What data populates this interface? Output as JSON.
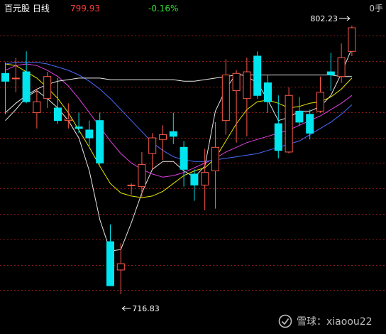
{
  "header": {
    "title": "百元股 日线",
    "price": "799.93",
    "change": "-0.16%",
    "volume_label": "0手"
  },
  "watermark": {
    "text": "雪球：xiaoou22"
  },
  "colors": {
    "background": "#000000",
    "up_candle": "#ff5a4a",
    "down_candle": "#00e5ee",
    "grid": "#8b1a1a",
    "ma_white": "#e8e8e8",
    "ma_yellow": "#e6e600",
    "ma_magenta": "#e040e0",
    "ma_blue": "#4a6cff",
    "price_up": "#ff3b3b",
    "price_down": "#33dd33"
  },
  "chart_data": {
    "type": "candlestick",
    "period": "日线",
    "ylim": [
      710,
      810
    ],
    "max_label": "802.23",
    "min_label": "716.83",
    "grid": true,
    "candles": [
      {
        "o": 787.0,
        "c": 784.5,
        "h": 790.5,
        "l": 774.0
      },
      {
        "o": 785.5,
        "c": 785.5,
        "h": 792.0,
        "l": 781.0
      },
      {
        "o": 787.5,
        "c": 778.0,
        "h": 794.0,
        "l": 777.5
      },
      {
        "o": 774.5,
        "c": 778.0,
        "h": 782.0,
        "l": 769.5
      },
      {
        "o": 779.0,
        "c": 786.0,
        "h": 787.5,
        "l": 776.0
      },
      {
        "o": 776.0,
        "c": 772.0,
        "h": 785.5,
        "l": 771.0
      },
      {
        "o": 772.0,
        "c": 772.5,
        "h": 777.5,
        "l": 769.5
      },
      {
        "o": 770.0,
        "c": 769.5,
        "h": 774.5,
        "l": 768.0
      },
      {
        "o": 769.0,
        "c": 766.5,
        "h": 772.0,
        "l": 764.0
      },
      {
        "o": 772.0,
        "c": 758.5,
        "h": 774.5,
        "l": 758.0
      },
      {
        "o": 733.5,
        "c": 719.5,
        "h": 739.0,
        "l": 719.5
      },
      {
        "o": 724.5,
        "c": 726.5,
        "h": 733.0,
        "l": 716.8
      },
      {
        "o": 751.5,
        "c": 751.5,
        "h": 752.0,
        "l": 748.5
      },
      {
        "o": 751.0,
        "c": 758.0,
        "h": 762.0,
        "l": 747.5
      },
      {
        "o": 761.5,
        "c": 766.5,
        "h": 768.0,
        "l": 756.5
      },
      {
        "o": 766.0,
        "c": 767.5,
        "h": 770.5,
        "l": 759.5
      },
      {
        "o": 768.5,
        "c": 767.0,
        "h": 774.5,
        "l": 764.5
      },
      {
        "o": 763.5,
        "c": 756.5,
        "h": 765.5,
        "l": 751.0
      },
      {
        "o": 755.0,
        "c": 751.5,
        "h": 756.5,
        "l": 746.5
      },
      {
        "o": 751.5,
        "c": 755.5,
        "h": 763.0,
        "l": 743.5
      },
      {
        "o": 756.0,
        "c": 763.5,
        "h": 771.5,
        "l": 744.0
      },
      {
        "o": 772.0,
        "c": 786.5,
        "h": 791.5,
        "l": 767.5
      },
      {
        "o": 781.5,
        "c": 787.0,
        "h": 788.0,
        "l": 765.0
      },
      {
        "o": 779.0,
        "c": 787.5,
        "h": 792.0,
        "l": 767.0
      },
      {
        "o": 792.5,
        "c": 780.0,
        "h": 794.0,
        "l": 779.0
      },
      {
        "o": 784.0,
        "c": 778.0,
        "h": 786.5,
        "l": 774.5
      },
      {
        "o": 771.0,
        "c": 762.5,
        "h": 780.0,
        "l": 760.0
      },
      {
        "o": 762.0,
        "c": 780.0,
        "h": 782.5,
        "l": 761.5
      },
      {
        "o": 775.0,
        "c": 771.5,
        "h": 779.5,
        "l": 770.5
      },
      {
        "o": 774.0,
        "c": 768.0,
        "h": 775.5,
        "l": 766.0
      },
      {
        "o": 775.0,
        "c": 781.0,
        "h": 786.0,
        "l": 774.5
      },
      {
        "o": 787.5,
        "c": 786.5,
        "h": 793.5,
        "l": 781.5
      },
      {
        "o": 786.0,
        "c": 792.0,
        "h": 796.5,
        "l": 784.0
      },
      {
        "o": 794.0,
        "c": 801.5,
        "h": 802.2,
        "l": 792.5
      }
    ],
    "ma_lines": [
      {
        "color": "#e8e8e8",
        "y": [
          772.0,
          775.5,
          779.5,
          781.5,
          779.0,
          776.0,
          772.0,
          766.5,
          756.0,
          740.5,
          730.5,
          731.0,
          739.5,
          749.0,
          756.5,
          759.0,
          759.0,
          756.0,
          754.0,
          757.5,
          775.0,
          782.0,
          787.0,
          786.0,
          784.0,
          778.5,
          772.0,
          773.0,
          775.0,
          775.0,
          776.5,
          780.0,
          787.0,
          795.0
        ]
      },
      {
        "color": "#e6e600",
        "y": [
          790.0,
          789.5,
          787.5,
          785.5,
          782.5,
          779.0,
          774.5,
          769.0,
          763.5,
          757.5,
          752.0,
          749.0,
          748.0,
          747.5,
          748.0,
          749.5,
          752.0,
          754.5,
          756.0,
          757.0,
          760.0,
          765.5,
          771.0,
          775.5,
          778.0,
          778.5,
          777.5,
          776.0,
          776.5,
          777.5,
          778.0,
          779.5,
          782.0,
          785.5
        ]
      },
      {
        "color": "#e040e0",
        "y": [
          788.0,
          789.5,
          790.0,
          789.5,
          788.0,
          786.0,
          783.0,
          779.0,
          774.5,
          770.0,
          765.5,
          761.5,
          758.5,
          756.5,
          755.0,
          754.0,
          754.5,
          755.5,
          757.0,
          758.5,
          760.0,
          762.0,
          763.5,
          765.0,
          766.0,
          767.0,
          768.0,
          769.0,
          770.5,
          772.0,
          773.5,
          775.5,
          777.5,
          780.0
        ]
      },
      {
        "color": "#4a6cff",
        "y": [
          790.0,
          790.5,
          790.5,
          790.5,
          790.0,
          789.0,
          788.0,
          786.5,
          784.5,
          782.0,
          779.0,
          775.5,
          772.0,
          768.5,
          765.0,
          762.5,
          760.5,
          759.5,
          759.0,
          759.0,
          759.5,
          760.0,
          760.5,
          761.0,
          761.5,
          762.5,
          763.5,
          764.5,
          765.5,
          767.5,
          769.5,
          771.5,
          774.0,
          777.0
        ]
      },
      {
        "color": "#e8e8e8",
        "y": [
          774.5,
          777.5,
          780.0,
          782.0,
          783.5,
          784.5,
          785.0,
          785.5,
          785.5,
          785.5,
          785.0,
          785.0,
          785.0,
          785.0,
          785.0,
          785.0,
          785.0,
          784.5,
          784.5,
          785.0,
          785.5,
          786.0,
          786.5,
          786.5,
          786.5,
          786.5,
          786.5,
          786.5,
          786.5,
          786.5,
          786.5,
          786.5,
          786.0,
          786.0
        ]
      }
    ]
  }
}
